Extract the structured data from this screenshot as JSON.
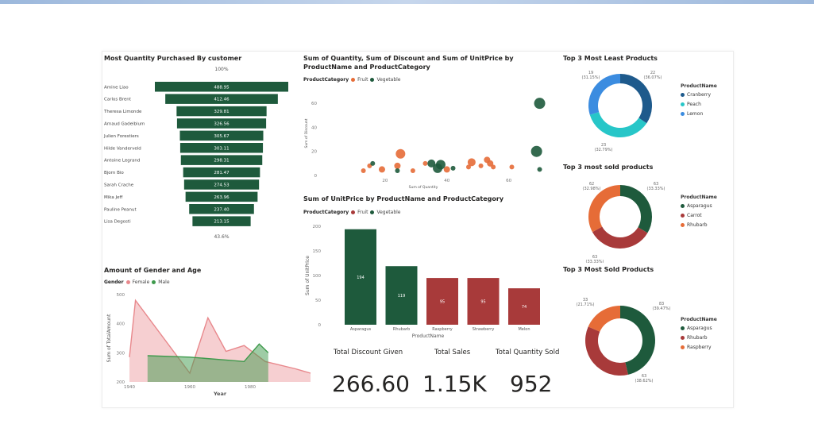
{
  "funnel": {
    "title": "Most Quantity Purchased By customer",
    "top_pct": "100%",
    "bottom_pct": "43.6%",
    "color": "#1e5a3c"
  },
  "scatter": {
    "title_line1": "Sum of Quantity, Sum of Discount and Sum of UnitPrice by",
    "title_line2": "ProductName and ProductCategory",
    "legend_label": "ProductCategory",
    "xlabel": "Sum of Quantity",
    "ylabel": "Sum of Discount",
    "series_names": [
      "Fruit",
      "Vegetable"
    ]
  },
  "bar": {
    "title": "Sum of UnitPrice by ProductName and ProductCategory",
    "legend_label": "ProductCategory",
    "series_names": [
      "Fruit",
      "Vegetable"
    ]
  },
  "area": {
    "title": "Amount of Gender and Age",
    "legend_label": "Gender",
    "series_names": [
      "Female",
      "Male"
    ]
  },
  "donut1": {
    "title": "Top 3 Most Least Products",
    "legend_title": "ProductName"
  },
  "donut2": {
    "title": "Top 3 most sold products",
    "legend_title": "ProductName"
  },
  "donut3": {
    "title": "Top 3 Most Sold Products",
    "legend_title": "ProductName"
  },
  "kpis": [
    {
      "label": "Total Discount Given",
      "value": "266.60"
    },
    {
      "label": "Total Sales",
      "value": "1.15K"
    },
    {
      "label": "Total Quantity Sold",
      "value": "952"
    }
  ],
  "colors": {
    "vegetable": "#1e5a3c",
    "fruit": "#e66c37",
    "bar_fruit": "#a83a3a",
    "female": "#e8888c",
    "male": "#3e9a4c",
    "navy": "#1e5a8c",
    "teal": "#27c6c8",
    "blue": "#3b8ce0"
  },
  "chart_data": [
    {
      "type": "bar",
      "title": "Most Quantity Purchased By customer",
      "orientation": "funnel",
      "categories": [
        "Amine Liao",
        "Carlos Brent",
        "Theresa Limonde",
        "Arnaud Gadelblum",
        "Julien Forestiers",
        "Hilde Vanderveld",
        "Antoine Legrand",
        "Bjorn Bio",
        "Sarah Crache",
        "Mika Jeff",
        "Pauline Peanut",
        "Lisa Degosti"
      ],
      "values": [
        488.95,
        412.46,
        329.81,
        326.56,
        305.67,
        303.11,
        298.31,
        281.47,
        274.53,
        263.96,
        237.4,
        213.15
      ],
      "value_labels": [
        "488.95",
        "412.46",
        "329.81",
        "326.56",
        "305.67",
        "303.11",
        "298.31",
        "281.47",
        "274.53",
        "263.96",
        "237.40",
        "213.15"
      ]
    },
    {
      "type": "scatter",
      "title": "Sum of Quantity, Sum of Discount and Sum of UnitPrice by ProductName and ProductCategory",
      "xlabel": "Sum of Quantity",
      "ylabel": "Sum of Discount",
      "xlim": [
        0,
        75
      ],
      "ylim": [
        0,
        70
      ],
      "x_ticks": [
        20,
        40,
        60
      ],
      "y_ticks": [
        0,
        20,
        40,
        60
      ],
      "series": [
        {
          "name": "Fruit",
          "points": [
            [
              13,
              4,
              3
            ],
            [
              15,
              8,
              3
            ],
            [
              19,
              5,
              4
            ],
            [
              24,
              8,
              4
            ],
            [
              25,
              18,
              6
            ],
            [
              29,
              4,
              3
            ],
            [
              33,
              10,
              3
            ],
            [
              40,
              5,
              4
            ],
            [
              47,
              7,
              3
            ],
            [
              48,
              11,
              5
            ],
            [
              51,
              8,
              3
            ],
            [
              53,
              13,
              4
            ],
            [
              54,
              10,
              4
            ],
            [
              55,
              7,
              3
            ],
            [
              61,
              7,
              3
            ]
          ]
        },
        {
          "name": "Vegetable",
          "points": [
            [
              16,
              10,
              3
            ],
            [
              24,
              4,
              3
            ],
            [
              35,
              10,
              5
            ],
            [
              37,
              6,
              6
            ],
            [
              38,
              9,
              6
            ],
            [
              42,
              6,
              3
            ],
            [
              69,
              20,
              7
            ],
            [
              70,
              60,
              7
            ],
            [
              70,
              5,
              3
            ]
          ]
        }
      ]
    },
    {
      "type": "bar",
      "title": "Sum of UnitPrice by ProductName and ProductCategory",
      "xlabel": "ProductName",
      "ylabel": "Sum of UnitPrice",
      "ylim": [
        0,
        200
      ],
      "y_ticks": [
        0,
        50,
        100,
        150,
        200
      ],
      "categories": [
        "Asparagus",
        "Rhubarb",
        "Raspberry",
        "Strawberry",
        "Melon"
      ],
      "values": [
        194,
        119,
        95,
        95,
        74
      ],
      "value_labels": [
        "194",
        "119",
        "95",
        "95",
        "74"
      ],
      "series_by_category": [
        "Vegetable",
        "Vegetable",
        "Fruit",
        "Fruit",
        "Fruit"
      ]
    },
    {
      "type": "area",
      "title": "Amount of Gender and Age",
      "xlabel": "Year",
      "ylabel": "Sum of TotalAmount",
      "xlim": [
        1940,
        2000
      ],
      "ylim": [
        200,
        500
      ],
      "x_ticks": [
        1940,
        1960,
        1980
      ],
      "y_ticks": [
        200,
        300,
        400,
        500
      ],
      "series": [
        {
          "name": "Female",
          "x": [
            1940,
            1942,
            1960,
            1966,
            1972,
            1978,
            1985,
            1995,
            2000
          ],
          "values": [
            285,
            480,
            230,
            420,
            305,
            325,
            270,
            245,
            230
          ]
        },
        {
          "name": "Male",
          "x": [
            1946,
            1960,
            1978,
            1983,
            1986
          ],
          "values": [
            290,
            285,
            270,
            330,
            300
          ]
        }
      ]
    },
    {
      "type": "pie",
      "title": "Top 3 Most Least Products",
      "categories": [
        "Cranberry",
        "Peach",
        "Lemon"
      ],
      "values": [
        22,
        23,
        19
      ],
      "value_labels": [
        "22",
        "23",
        "19"
      ],
      "percent_labels": [
        "(36.07%)",
        "(32.79%)",
        "(31.15%)"
      ]
    },
    {
      "type": "pie",
      "title": "Top 3 most sold products",
      "categories": [
        "Asparagus",
        "Carrot",
        "Rhubarb"
      ],
      "values": [
        63,
        63,
        62
      ],
      "value_labels": [
        "63",
        "63",
        "62"
      ],
      "percent_labels": [
        "(33.33%)",
        "(33.33%)",
        "(32.98%)"
      ]
    },
    {
      "type": "pie",
      "title": "Top 3 Most Sold Products",
      "categories": [
        "Asparagus",
        "Rhubarb",
        "Raspberry"
      ],
      "values": [
        83,
        63,
        33
      ],
      "value_labels": [
        "83",
        "63",
        "33"
      ],
      "percent_labels": [
        "(39.47%)",
        "(38.62%)",
        "(21.71%)"
      ]
    }
  ]
}
